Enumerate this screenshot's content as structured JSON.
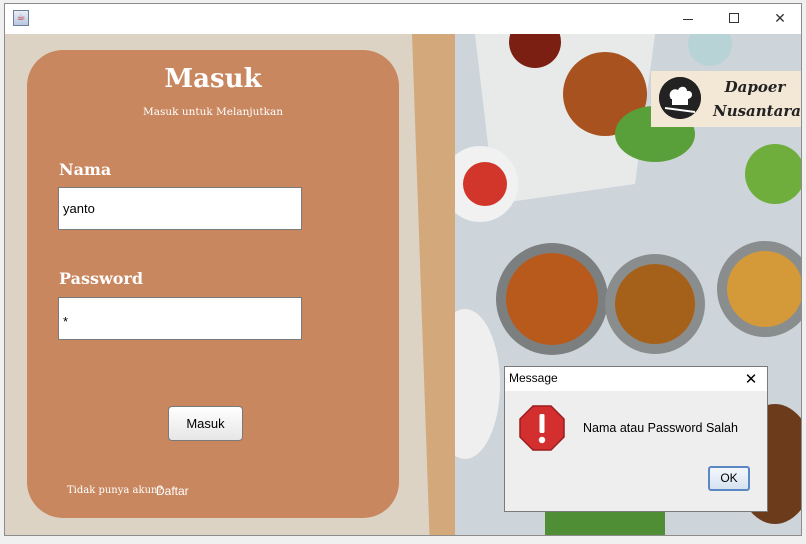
{
  "window": {
    "title": ""
  },
  "login": {
    "title": "Masuk",
    "subtitle": "Masuk untuk Melanjutkan",
    "name_label": "Nama",
    "name_value": "yanto",
    "password_label": "Password",
    "password_value": "*",
    "submit_label": "Masuk",
    "no_account_text": "Tidak punya akun?",
    "register_link": "Daftar"
  },
  "brand": {
    "line1": "Dapoer",
    "line2": "Nusantara"
  },
  "dialog": {
    "title": "Message",
    "message": "Nama atau Password Salah",
    "ok_label": "OK",
    "icon": "error-icon"
  },
  "colors": {
    "panel": "#c8875f",
    "background": "#dcd3c5",
    "divider": "#d3a87b",
    "error": "#d32f2f"
  }
}
